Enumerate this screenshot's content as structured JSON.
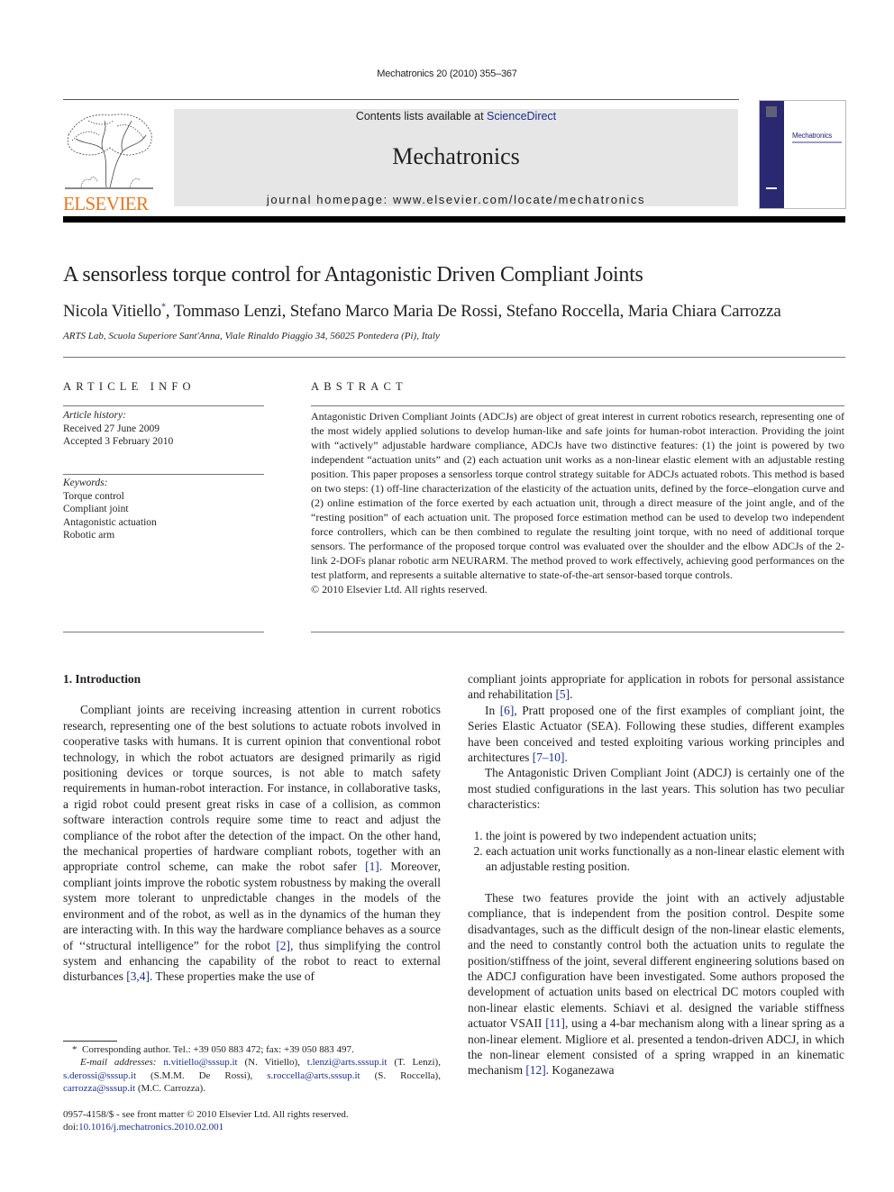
{
  "header": {
    "citation": "Mechatronics 20 (2010) 355–367",
    "contents_prefix": "Contents lists available at ",
    "contents_link": "ScienceDirect",
    "journal_name": "Mechatronics",
    "homepage": "journal homepage: www.elsevier.com/locate/mechatronics",
    "publisher_logo_text": "ELSEVIER",
    "cover_title": "Mechatronics",
    "colors": {
      "elsevier_orange": "#e87722",
      "link_blue": "#1c2f8a",
      "cover_navy": "#2a2870",
      "banner_gray": "#e6e6e6"
    }
  },
  "article": {
    "title": "A sensorless torque control for Antagonistic Driven Compliant Joints",
    "authors": "Nicola Vitiello",
    "authors_mark": "*",
    "authors_rest": ", Tommaso Lenzi, Stefano Marco Maria De Rossi, Stefano Roccella, Maria Chiara Carrozza",
    "affiliation": "ARTS Lab, Scuola Superiore Sant'Anna, Viale Rinaldo Piaggio 34, 56025 Pontedera (Pi), Italy"
  },
  "article_info": {
    "heading": "ARTICLE INFO",
    "history_label": "Article history:",
    "received": "Received 27 June 2009",
    "accepted": "Accepted 3 February 2010",
    "keywords_label": "Keywords:",
    "keywords": [
      "Torque control",
      "Compliant joint",
      "Antagonistic actuation",
      "Robotic arm"
    ]
  },
  "abstract": {
    "heading": "ABSTRACT",
    "text": "Antagonistic Driven Compliant Joints (ADCJs) are object of great interest in current robotics research, representing one of the most widely applied solutions to develop human-like and safe joints for human-robot interaction. Providing the joint with “actively” adjustable hardware compliance, ADCJs have two distinctive features: (1) the joint is powered by two independent “actuation units” and (2) each actuation unit works as a non-linear elastic element with an adjustable resting position. This paper proposes a sensorless torque control strategy suitable for ADCJs actuated robots. This method is based on two steps: (1) off-line characterization of the elasticity of the actuation units, defined by the force–elongation curve and (2) online estimation of the force exerted by each actuation unit, through a direct measure of the joint angle, and of the “resting position” of each actuation unit. The proposed force estimation method can be used to develop two independent force controllers, which can be then combined to regulate the resulting joint torque, with no need of additional torque sensors. The performance of the proposed torque control was evaluated over the shoulder and the elbow ADCJs of the 2-link 2-DOFs planar robotic arm NEURARM. The method proved to work effectively, achieving good performances on the test platform, and represents a suitable alternative to state-of-the-art sensor-based torque controls.",
    "copyright": "© 2010 Elsevier Ltd. All rights reserved."
  },
  "body": {
    "section_heading": "1. Introduction",
    "left_p1_a": "Compliant joints are receiving increasing attention in current robotics research, representing one of the best solutions to actuate robots involved in cooperative tasks with humans. It is current opinion that conventional robot technology, in which the robot actuators are designed primarily as rigid positioning devices or torque sources, is not able to match safety requirements in human-robot interaction. For instance, in collaborative tasks, a rigid robot could present great risks in case of a collision, as common software interaction controls require some time to react and adjust the compliance of the robot after the detection of the impact. On the other hand, the mechanical properties of hardware compliant robots, together with an appropriate control scheme, can make the robot safer ",
    "ref1": "[1]",
    "left_p1_b": ". Moreover, compliant joints improve the robotic system robustness by making the overall system more tolerant to unpredictable changes in the models of the environment and of the robot, as well as in the dynamics of the human they are interacting with. In this way the hardware compliance behaves as a source of ‘‘structural intelligence” for the robot ",
    "ref2": "[2]",
    "left_p1_c": ", thus simplifying the control system and enhancing the capability of the robot to react to external disturbances ",
    "ref34": "[3,4]",
    "left_p1_d": ". These properties make the use of",
    "right_p1_a": "compliant joints appropriate for application in robots for personal assistance and rehabilitation ",
    "ref5": "[5]",
    "right_p1_b": ".",
    "right_p2_a": "In ",
    "ref6": "[6]",
    "right_p2_b": ", Pratt proposed one of the first examples of compliant joint, the Series Elastic Actuator (SEA). Following these studies, different examples have been conceived and tested exploiting various working principles and architectures ",
    "ref710": "[7–10]",
    "right_p2_c": ".",
    "right_p3": "The Antagonistic Driven Compliant Joint (ADCJ) is certainly one of the most studied configurations in the last years. This solution has two peculiar characteristics:",
    "list": [
      "the joint is powered by two independent actuation units;",
      "each actuation unit works functionally as a non-linear elastic element with an adjustable resting position."
    ],
    "right_p4_a": "These two features provide the joint with an actively adjustable compliance, that is independent from the position control. Despite some disadvantages, such as the difficult design of the non-linear elastic elements, and the need to constantly control both the actuation units to regulate the position/stiffness of the joint, several different engineering solutions based on the ADCJ configuration have been investigated. Some authors proposed the development of actuation units based on electrical DC motors coupled with non-linear elastic elements. Schiavi et al. designed the variable stiffness actuator VSAII ",
    "ref11": "[11]",
    "right_p4_b": ", using a 4-bar mechanism along with a linear spring as a non-linear element. Migliore et al. presented a tendon-driven ADCJ, in which the non-linear element consisted of a spring wrapped in an kinematic mechanism ",
    "ref12": "[12]",
    "right_p4_c": ". Koganezawa"
  },
  "footnotes": {
    "corresponding_mark": "*",
    "corresponding": "Corresponding author. Tel.: +39 050 883 472; fax: +39 050 883 497.",
    "email_label": "E-mail addresses:",
    "emails": [
      {
        "email": "n.vitiello@sssup.it",
        "name": " (N. Vitiello), "
      },
      {
        "email": "t.lenzi@arts.sssup.it",
        "name": " (T. Lenzi), "
      },
      {
        "email": "s.derossi@sssup.it",
        "name": " (S.M.M. De Rossi), "
      },
      {
        "email": "s.roccella@arts.sssup.it",
        "name": " (S. Roccella), "
      },
      {
        "email": "carrozza@sssup.it",
        "name": " (M.C. Carrozza)."
      }
    ],
    "front_matter": "0957-4158/$ - see front matter © 2010 Elsevier Ltd. All rights reserved.",
    "doi_prefix": "doi:",
    "doi": "10.1016/j.mechatronics.2010.02.001"
  }
}
